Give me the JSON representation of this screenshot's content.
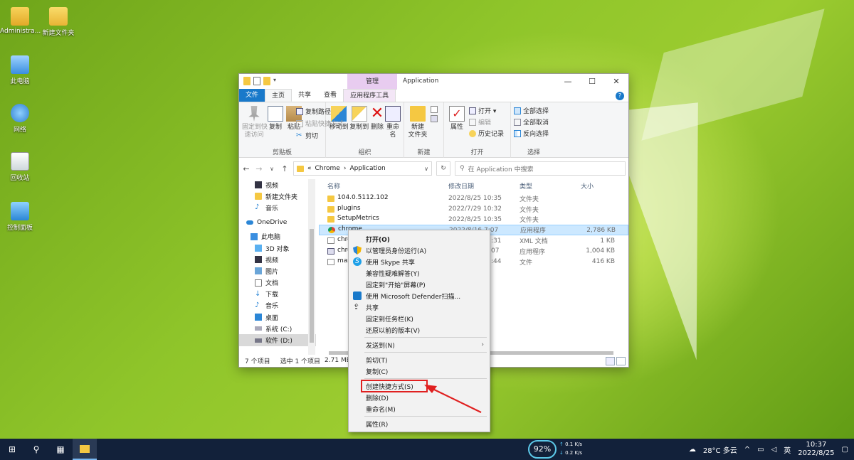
{
  "desktop": {
    "icons": [
      {
        "label": "Administra..."
      },
      {
        "label": "新建文件夹"
      },
      {
        "label": "此电脑"
      },
      {
        "label": "网络"
      },
      {
        "label": "回收站"
      },
      {
        "label": "控制面板"
      }
    ]
  },
  "window": {
    "title": "Application",
    "context_tab": "管理",
    "controls": [
      "—",
      "☐",
      "✕"
    ],
    "tabs": {
      "file": "文件",
      "home": "主页",
      "share": "共享",
      "view": "查看",
      "app_tools": "应用程序工具"
    },
    "ribbon": {
      "pin": "固定到快\n速访问",
      "copy": "复制",
      "paste": "粘贴",
      "copy_path": "复制路径",
      "paste_shortcut": "粘贴快捷方式",
      "cut": "剪切",
      "clipboard": "剪贴板",
      "move_to": "移动到",
      "copy_to": "复制到",
      "delete": "删除",
      "rename": "重命名",
      "organize": "组织",
      "new_folder": "新建\n文件夹",
      "new": "新建",
      "properties": "属性",
      "open": "打开 ▾",
      "edit": "编辑",
      "history": "历史记录",
      "open_group": "打开",
      "select_all": "全部选择",
      "select_none": "全部取消",
      "invert": "反向选择",
      "select": "选择"
    },
    "address": {
      "prefix": "«",
      "crumb1": "Chrome",
      "sep": "›",
      "crumb2": "Application",
      "search_placeholder": "在 Application 中搜索"
    },
    "nav": [
      {
        "label": "视频"
      },
      {
        "label": "新建文件夹"
      },
      {
        "label": "音乐"
      },
      {
        "label": "OneDrive"
      },
      {
        "label": "此电脑"
      },
      {
        "label": "3D 对象"
      },
      {
        "label": "视频"
      },
      {
        "label": "图片"
      },
      {
        "label": "文档"
      },
      {
        "label": "下载"
      },
      {
        "label": "音乐"
      },
      {
        "label": "桌面"
      },
      {
        "label": "系统 (C:)"
      },
      {
        "label": "软件 (D:)"
      }
    ],
    "columns": {
      "name": "名称",
      "date": "修改日期",
      "type": "类型",
      "size": "大小"
    },
    "files": [
      {
        "name": "104.0.5112.102",
        "date": "2022/8/25 10:35",
        "type": "文件夹",
        "size": ""
      },
      {
        "name": "plugins",
        "date": "2022/7/29 10:32",
        "type": "文件夹",
        "size": ""
      },
      {
        "name": "SetupMetrics",
        "date": "2022/8/25 10:35",
        "type": "文件夹",
        "size": ""
      },
      {
        "name": "chrome",
        "date": "2022/8/16 7:07",
        "type": "应用程序",
        "size": "2,786 KB"
      },
      {
        "name": "chro",
        "date": ":31",
        "type": "XML 文档",
        "size": "1 KB"
      },
      {
        "name": "chro",
        "date": "07",
        "type": "应用程序",
        "size": "1,004 KB"
      },
      {
        "name": "mas",
        "date": ":44",
        "type": "文件",
        "size": "416 KB"
      }
    ],
    "status": {
      "count": "7 个项目",
      "selected": "选中 1 个项目",
      "size": "2.71 MB"
    }
  },
  "context_menu": {
    "items": [
      "打开(O)",
      "以管理员身份运行(A)",
      "使用 Skype 共享",
      "兼容性疑难解答(Y)",
      "固定到\"开始\"屏幕(P)",
      "使用 Microsoft Defender扫描...",
      "共享",
      "固定到任务栏(K)",
      "还原以前的版本(V)",
      "发送到(N)",
      "剪切(T)",
      "复制(C)",
      "创建快捷方式(S)",
      "删除(D)",
      "重命名(M)",
      "属性(R)"
    ]
  },
  "taskbar": {
    "cpu": "92%",
    "net_up": "0.1",
    "net_down": "0.2",
    "net_unit": "K/s",
    "weather": "28°C 多云",
    "ime": "英",
    "time": "10:37",
    "date": "2022/8/25"
  },
  "colors": {
    "accent": "#1979ca",
    "highlight": "#e02020",
    "taskbar": "#12213a"
  }
}
